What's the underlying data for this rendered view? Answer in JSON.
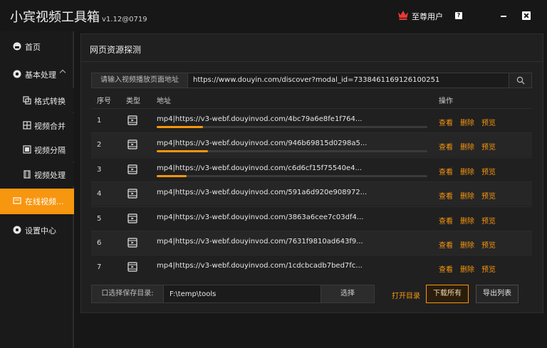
{
  "app": {
    "title": "小宾视频工具箱",
    "version": "v1.12@0719"
  },
  "header": {
    "vip_label": "至尊用户",
    "help": "?"
  },
  "sidebar": {
    "items": [
      {
        "label": "首页",
        "icon": "home-icon"
      },
      {
        "label": "基本处理",
        "icon": "gear-icon",
        "expanded": true
      },
      {
        "label": "格式转换",
        "icon": "convert-icon"
      },
      {
        "label": "视频合并",
        "icon": "merge-icon"
      },
      {
        "label": "视频分隔",
        "icon": "split-icon"
      },
      {
        "label": "视频处理",
        "icon": "film-icon"
      },
      {
        "label": "在线视频...",
        "icon": "online-icon",
        "active": true
      },
      {
        "label": "设置中心",
        "icon": "settings-icon"
      }
    ]
  },
  "panel": {
    "title": "网页资源探测",
    "url_label": "请输入视频播放页面地址",
    "url_value": "https://www.douyin.com/discover?modal_id=7338461169126100251"
  },
  "table": {
    "headers": {
      "no": "序号",
      "type": "类型",
      "addr": "地址",
      "ops": "操作"
    },
    "ops": {
      "view": "查看",
      "delete": "删除",
      "preview": "预览"
    },
    "rows": [
      {
        "no": "1",
        "addr": "mp4|https://v3-webf.douyinvod.com/4bc79a6e8fe1f764...",
        "progress": 0.17
      },
      {
        "no": "2",
        "addr": "mp4|https://v3-webf.douyinvod.com/946b69815d0298a5...",
        "progress": 0.19
      },
      {
        "no": "3",
        "addr": "mp4|https://v3-webf.douyinvod.com/c6d6cf15f75540e4...",
        "progress": 0.11
      },
      {
        "no": "4",
        "addr": "mp4|https://v3-webf.douyinvod.com/591a6d920e908972...",
        "progress": null
      },
      {
        "no": "5",
        "addr": "mp4|https://v3-webf.douyinvod.com/3863a6cee7c03df4...",
        "progress": null
      },
      {
        "no": "6",
        "addr": "mp4|https://v3-webf.douyinvod.com/7631f9810ad643f9...",
        "progress": null
      },
      {
        "no": "7",
        "addr": "mp4|https://v3-webf.douyinvod.com/1cdcbcadb7bed7fc...",
        "progress": null
      }
    ]
  },
  "bottom": {
    "dir_label": "口选择保存目录:",
    "dir_value": "F:\\temp\\tools",
    "choose": "选择",
    "open_dir": "打开目录",
    "download_all": "下载所有",
    "export": "导出列表"
  },
  "colors": {
    "accent": "#f7960f",
    "background": "#171717",
    "panel": "#202020"
  }
}
